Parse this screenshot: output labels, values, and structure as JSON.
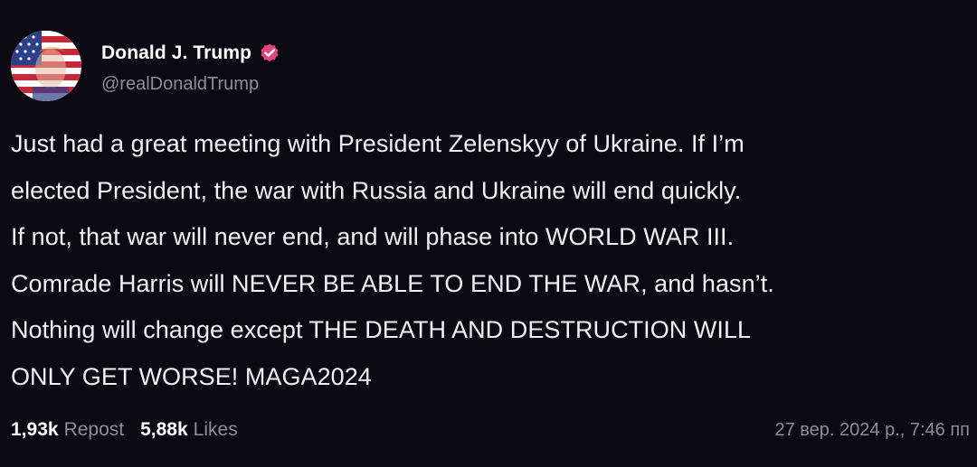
{
  "author": {
    "display_name": "Donald J. Trump",
    "handle": "@realDonaldTrump",
    "verified": true,
    "avatar_icon": "flag-portrait-avatar"
  },
  "post": {
    "lines": [
      "Just had a great meeting with President Zelenskyy of Ukraine. If I’m",
      "elected President, the war with Russia and Ukraine will end quickly.",
      "If not, that war will never end, and will phase into WORLD WAR III.",
      "Comrade Harris will NEVER BE ABLE TO END THE WAR, and hasn’t.",
      "Nothing will change except THE DEATH AND DESTRUCTION WILL",
      "ONLY GET WORSE!  MAGA2024"
    ]
  },
  "footer": {
    "reposts_count": "1,93k",
    "reposts_label": "Repost",
    "likes_count": "5,88k",
    "likes_label": "Likes",
    "timestamp": "27 вер. 2024 р., 7:46 пп"
  },
  "colors": {
    "background": "#0b0a13",
    "text": "#f1f1f3",
    "muted": "#8e8d98",
    "verified_badge": "#e0457b"
  }
}
